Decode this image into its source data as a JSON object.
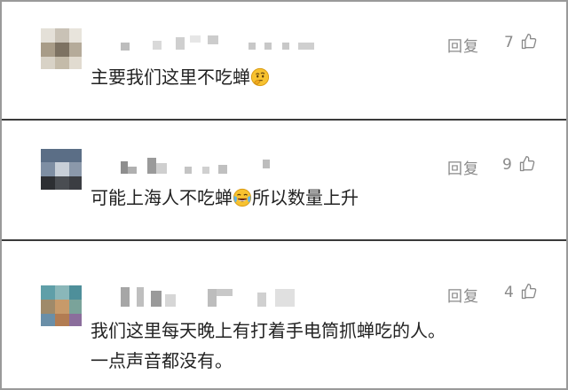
{
  "comments": [
    {
      "reply_label": "回复",
      "likes": "7",
      "text": "主要我们这里不吃蝉",
      "emoji": "thinking-face-emoji"
    },
    {
      "reply_label": "回复",
      "likes": "9",
      "text_before": "可能上海人不吃蝉",
      "emoji": "crying-laughing-face-emoji",
      "text_after": "所以数量上升"
    },
    {
      "reply_label": "回复",
      "likes": "4",
      "line1": "我们这里每天晚上有打着手电筒抓蝉吃的人。",
      "line2": "一点声音都没有。"
    }
  ],
  "colors": {
    "text": "#222222",
    "meta": "#8a8a8a",
    "divider": "#3a3a3a"
  },
  "icons": {
    "like": "thumbs-up-outline-icon"
  }
}
